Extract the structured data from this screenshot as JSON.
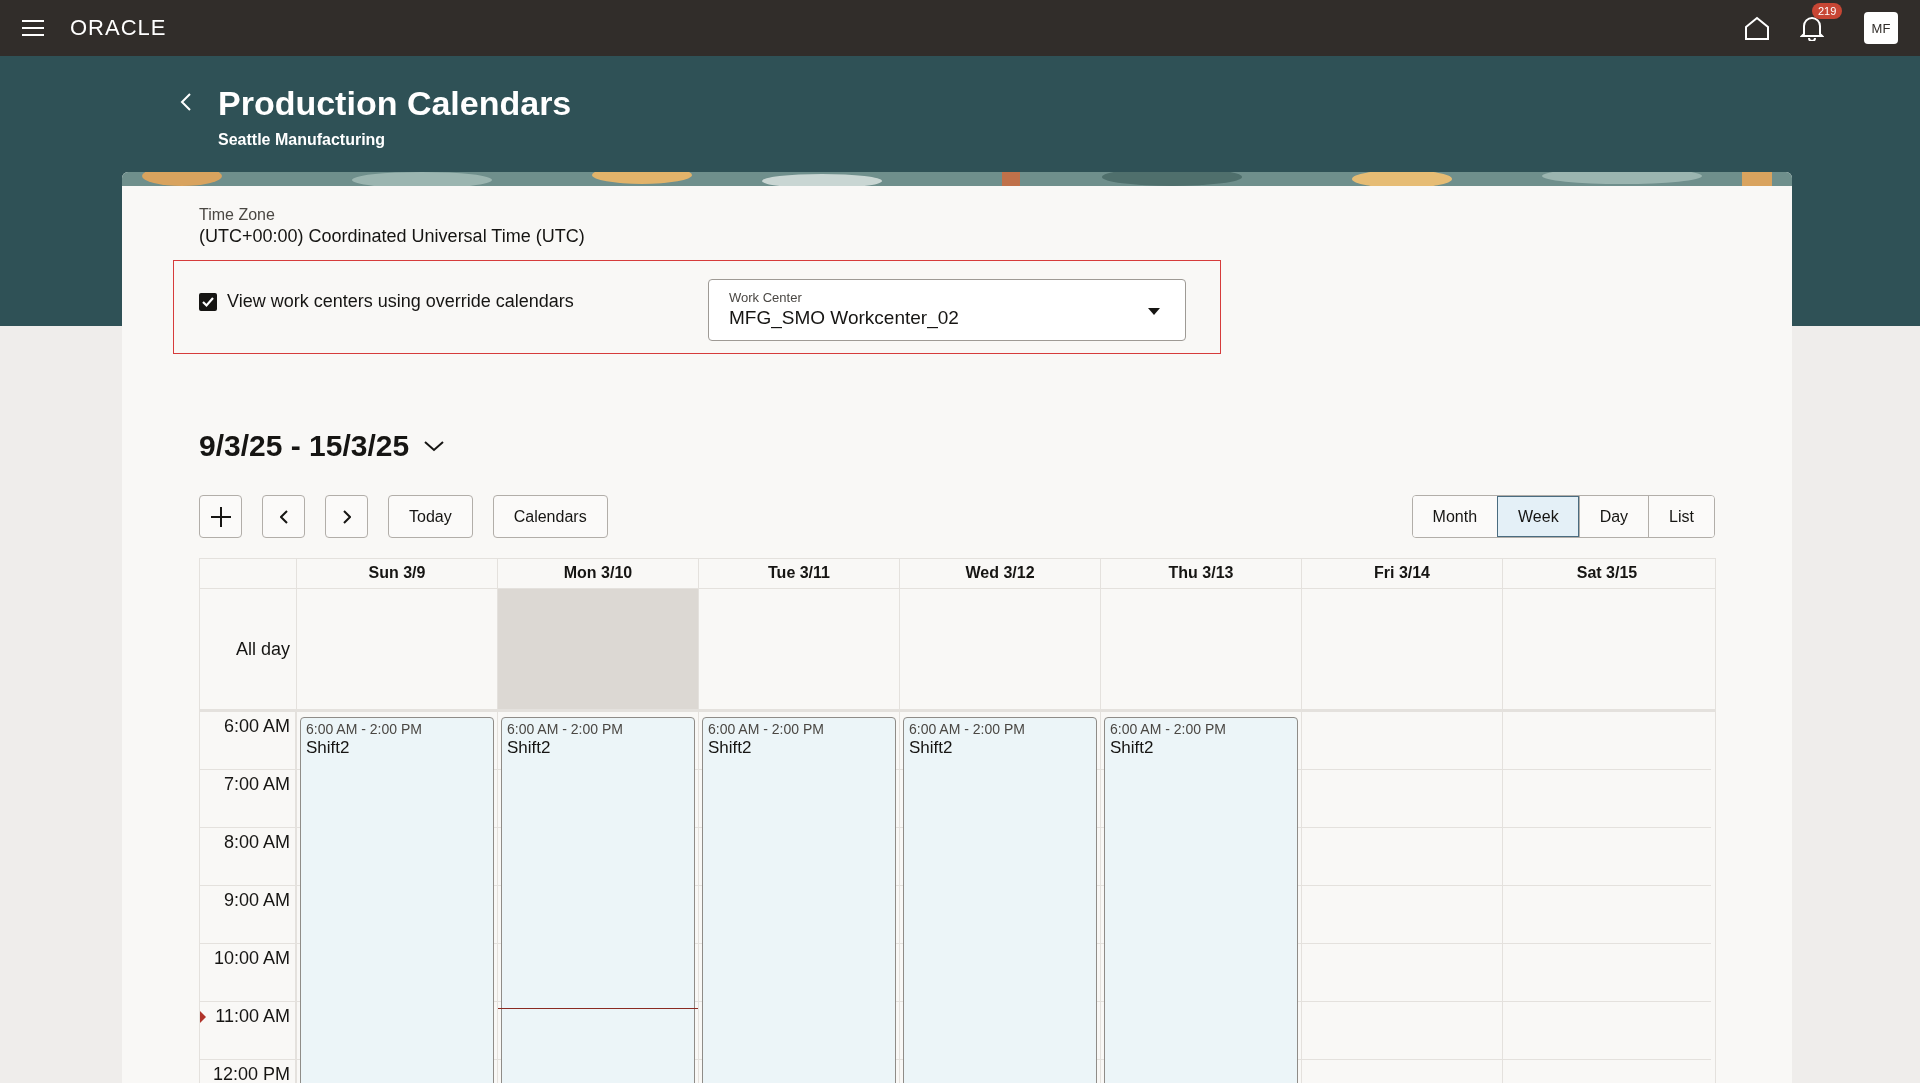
{
  "top_bar": {
    "brand": "ORACLE",
    "notifications": "219",
    "avatar": "MF"
  },
  "header": {
    "title": "Production Calendars",
    "subtitle": "Seattle Manufacturing"
  },
  "time_zone": {
    "label": "Time Zone",
    "value": "(UTC+00:00) Coordinated Universal Time (UTC)"
  },
  "override": {
    "label": "View work centers using override calendars",
    "checked": true
  },
  "work_center": {
    "label": "Work Center",
    "value": "MFG_SMO Workcenter_02"
  },
  "date_range": "9/3/25 - 15/3/25",
  "toolbar": [
    "Today",
    "Calendars"
  ],
  "views": [
    {
      "label": "Month",
      "selected": false
    },
    {
      "label": "Week",
      "selected": true
    },
    {
      "label": "Day",
      "selected": false
    },
    {
      "label": "List",
      "selected": false
    }
  ],
  "all_day_label": "All day",
  "days": [
    {
      "label": "Sun 3/9",
      "today": false,
      "events": [
        {
          "time": "6:00 AM - 2:00 PM",
          "title": "Shift2"
        }
      ]
    },
    {
      "label": "Mon 3/10",
      "today": true,
      "events": [
        {
          "time": "6:00 AM - 2:00 PM",
          "title": "Shift2"
        }
      ]
    },
    {
      "label": "Tue 3/11",
      "today": false,
      "events": [
        {
          "time": "6:00 AM - 2:00 PM",
          "title": "Shift2"
        }
      ]
    },
    {
      "label": "Wed 3/12",
      "today": false,
      "events": [
        {
          "time": "6:00 AM - 2:00 PM",
          "title": "Shift2"
        }
      ]
    },
    {
      "label": "Thu 3/13",
      "today": false,
      "events": [
        {
          "time": "6:00 AM - 2:00 PM",
          "title": "Shift2"
        }
      ]
    },
    {
      "label": "Fri 3/14",
      "today": false
    },
    {
      "label": "Sat 3/15",
      "today": false
    }
  ],
  "hours": [
    "6:00 AM",
    "7:00 AM",
    "8:00 AM",
    "9:00 AM",
    "10:00 AM",
    "11:00 AM",
    "12:00 PM"
  ]
}
